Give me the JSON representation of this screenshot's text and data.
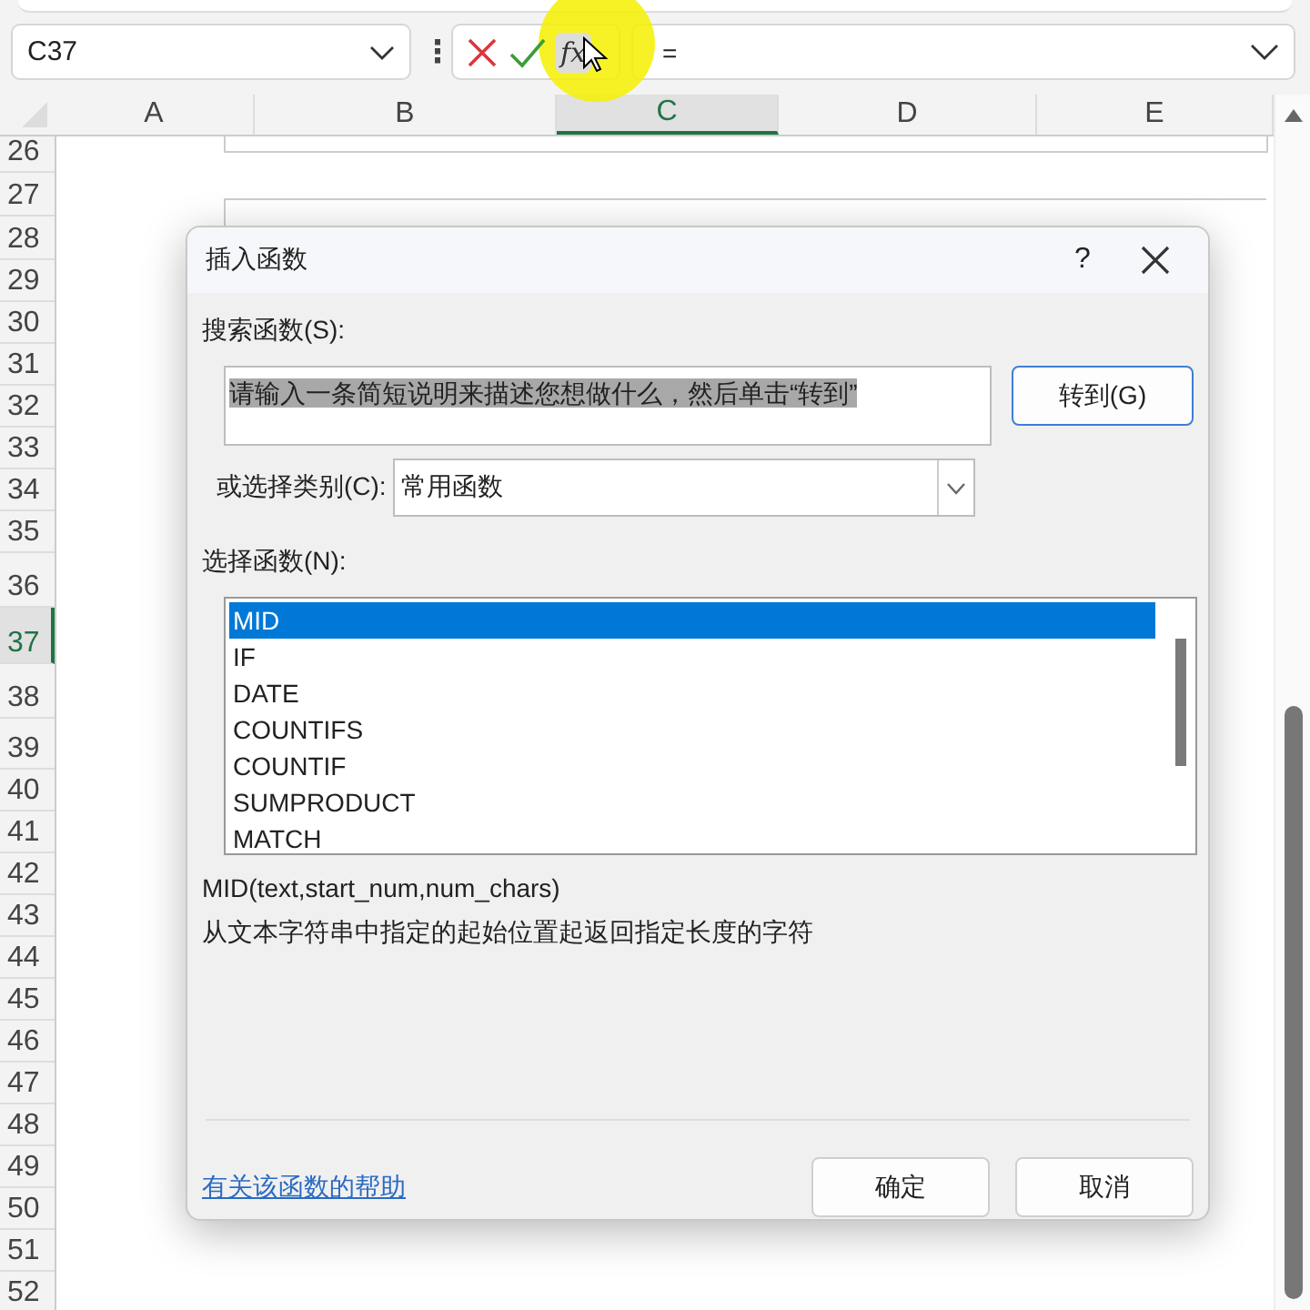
{
  "formula_bar": {
    "name_box": "C37",
    "more": "⋮",
    "function_button": "fx",
    "formula": "="
  },
  "sheet": {
    "columns": [
      {
        "label": "A",
        "selected": false
      },
      {
        "label": "B",
        "selected": false
      },
      {
        "label": "C",
        "selected": true
      },
      {
        "label": "D",
        "selected": false
      },
      {
        "label": "E",
        "selected": false
      }
    ],
    "rows": [
      {
        "label": "26",
        "selected": false
      },
      {
        "label": "27",
        "selected": false
      },
      {
        "label": "28",
        "selected": false
      },
      {
        "label": "29",
        "selected": false
      },
      {
        "label": "30",
        "selected": false
      },
      {
        "label": "31",
        "selected": false
      },
      {
        "label": "32",
        "selected": false
      },
      {
        "label": "33",
        "selected": false
      },
      {
        "label": "34",
        "selected": false
      },
      {
        "label": "35",
        "selected": false
      },
      {
        "label": "36",
        "selected": false
      },
      {
        "label": "37",
        "selected": true
      },
      {
        "label": "38",
        "selected": false
      },
      {
        "label": "39",
        "selected": false
      },
      {
        "label": "40",
        "selected": false
      },
      {
        "label": "41",
        "selected": false
      },
      {
        "label": "42",
        "selected": false
      },
      {
        "label": "43",
        "selected": false
      },
      {
        "label": "44",
        "selected": false
      },
      {
        "label": "45",
        "selected": false
      },
      {
        "label": "46",
        "selected": false
      },
      {
        "label": "47",
        "selected": false
      },
      {
        "label": "48",
        "selected": false
      },
      {
        "label": "49",
        "selected": false
      },
      {
        "label": "50",
        "selected": false
      },
      {
        "label": "51",
        "selected": false
      },
      {
        "label": "52",
        "selected": false
      }
    ]
  },
  "dialog": {
    "title": "插入函数",
    "help": "?",
    "search_label": "搜索函数(S):",
    "search_value": "请输入一条简短说明来描述您想做什么，然后单击“转到”",
    "search_text_selected": true,
    "go_button": "转到(G)",
    "category_label": "或选择类别(C):",
    "category_value": "常用函数",
    "list_label": "选择函数(N):",
    "functions": [
      {
        "name": "MID",
        "selected": true
      },
      {
        "name": "IF",
        "selected": false
      },
      {
        "name": "DATE",
        "selected": false
      },
      {
        "name": "COUNTIFS",
        "selected": false
      },
      {
        "name": "COUNTIF",
        "selected": false
      },
      {
        "name": "SUMPRODUCT",
        "selected": false
      },
      {
        "name": "MATCH",
        "selected": false
      }
    ],
    "signature": "MID(text,start_num,num_chars)",
    "description": "从文本字符串中指定的起始位置起返回指定长度的字符",
    "help_link": "有关该函数的帮助",
    "ok_button": "确定",
    "cancel_button": "取消"
  }
}
